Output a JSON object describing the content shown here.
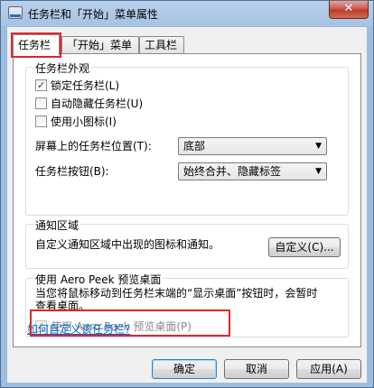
{
  "window": {
    "title": "任务栏和「开始」菜单属性",
    "close_label": "✕"
  },
  "tabs": [
    {
      "label": "任务栏"
    },
    {
      "label": "「开始」菜单"
    },
    {
      "label": "工具栏"
    }
  ],
  "appearance": {
    "group_title": "任务栏外观",
    "lock_label": "锁定任务栏(L)",
    "autohide_label": "自动隐藏任务栏(U)",
    "small_icons_label": "使用小图标(I)",
    "position_label": "屏幕上的任务栏位置(T):",
    "position_value": "底部",
    "buttons_label": "任务栏按钮(B):",
    "buttons_value": "始终合并、隐藏标签"
  },
  "notify": {
    "group_title": "通知区域",
    "description": "自定义通知区域中出现的图标和通知。",
    "customize_label": "自定义(C)..."
  },
  "peek": {
    "group_title": "使用 Aero Peek 预览桌面",
    "description_line1": "当您将鼠标移动到任务栏末端的“显示桌面”按钮时，会暂时",
    "description_line2": "查看桌面。",
    "checkbox_label": "使用 Aero Peek 预览桌面(P)"
  },
  "help_link": "如何自定义该任务栏?",
  "footer": {
    "ok_label": "确定",
    "cancel_label": "取消",
    "apply_label": "应用(A)"
  }
}
